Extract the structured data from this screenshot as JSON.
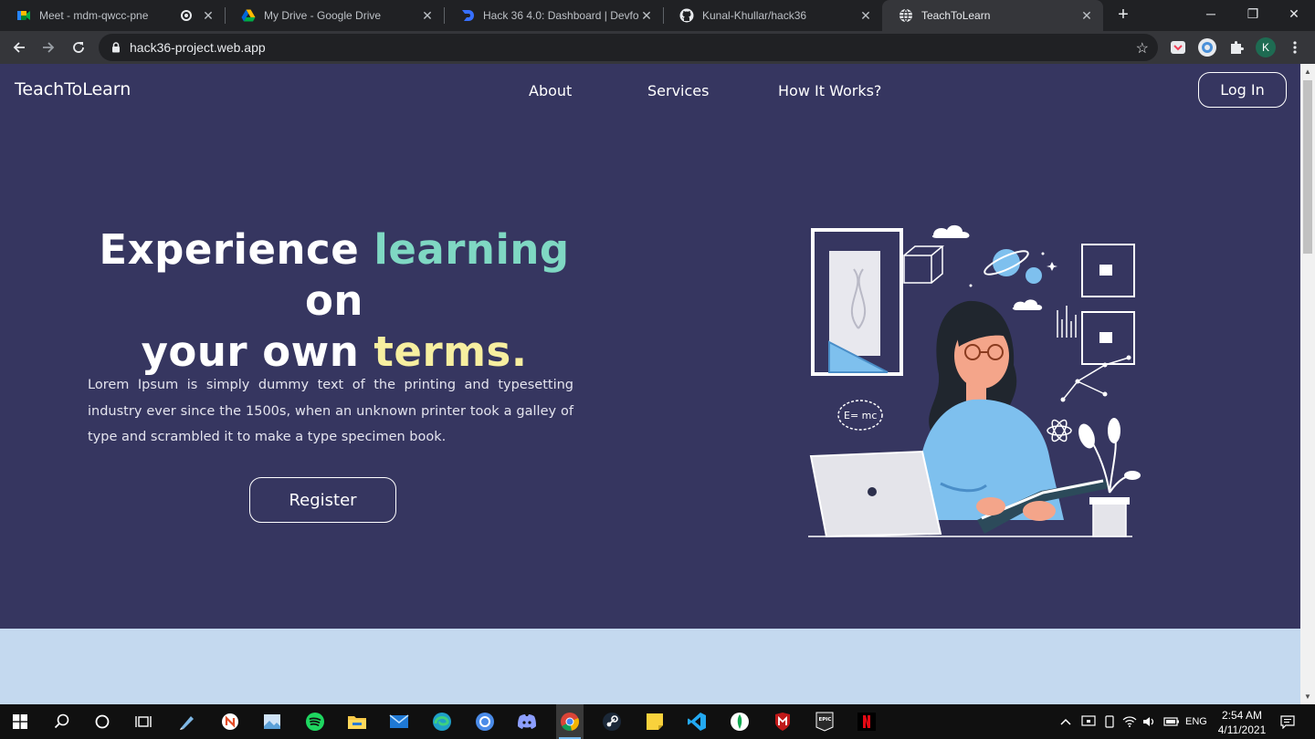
{
  "browser": {
    "tabs": [
      {
        "title": "Meet - mdm-qwcc-pne",
        "icon": "google-meet-icon"
      },
      {
        "title": "My Drive - Google Drive",
        "icon": "google-drive-icon"
      },
      {
        "title": "Hack 36 4.0: Dashboard | Devfolio",
        "icon": "devfolio-icon"
      },
      {
        "title": "Kunal-Khullar/hack36",
        "icon": "github-icon"
      },
      {
        "title": "TeachToLearn",
        "icon": "globe-icon",
        "active": true
      }
    ],
    "url": "hack36-project.web.app",
    "profile_initial": "K"
  },
  "site": {
    "brand": "TeachToLearn",
    "nav": {
      "about": "About",
      "services": "Services",
      "how": "How It Works?"
    },
    "login": "Log In"
  },
  "hero": {
    "title_1": "Experience",
    "title_2": "learning",
    "title_3": "on",
    "title_4": "your own",
    "title_5": "terms.",
    "text": "Lorem Ipsum is simply dummy text of the printing and typesetting industry ever since the 1500s, when an unknown printer took a galley of type and scrambled it to make a type specimen book.",
    "register": "Register",
    "formula": "E= mc"
  },
  "colors": {
    "page_bg": "#363660",
    "accent_teal": "#7fd8c3",
    "accent_yellow": "#f7efa0",
    "band": "#c4d9ef"
  },
  "taskbar": {
    "time": "2:54 AM",
    "date": "4/11/2021",
    "lang": "ENG"
  }
}
